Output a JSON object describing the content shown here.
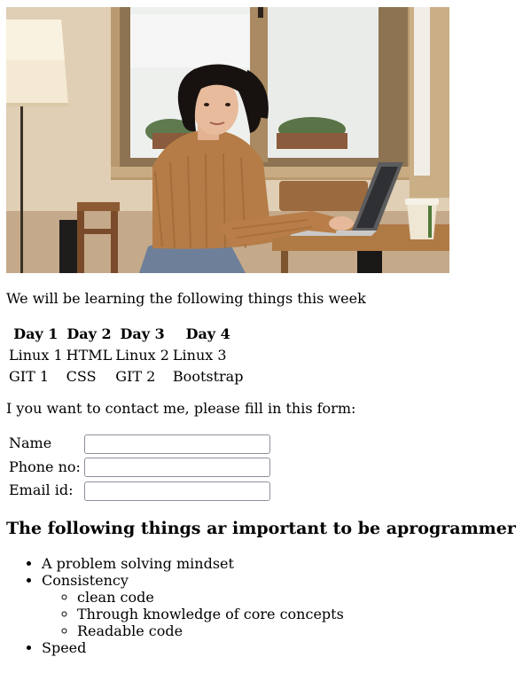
{
  "intro_text": "We will be learning the following things this week",
  "schedule": {
    "headers": [
      "Day 1",
      "Day 2",
      "Day 3",
      "Day 4"
    ],
    "rows": [
      [
        "Linux 1",
        "HTML",
        "Linux 2",
        "Linux 3"
      ],
      [
        "GIT 1",
        "CSS",
        "GIT 2",
        "Bootstrap"
      ]
    ]
  },
  "contact_text": "I you want to contact me, please fill in this form:",
  "form": {
    "name_label": "Name",
    "phone_label": "Phone no:",
    "email_label": "Email id:",
    "name_value": "",
    "phone_value": "",
    "email_value": ""
  },
  "heading": "The following things ar important to be aprogrammer",
  "skills": {
    "items": [
      "A problem solving mindset",
      "Consistency",
      "Speed"
    ],
    "consistency_subitems": [
      "clean code",
      "Through knowledge of core concepts",
      "Readable code"
    ]
  },
  "colors": {
    "input_border": "#8f8f9d",
    "text": "#000000"
  }
}
